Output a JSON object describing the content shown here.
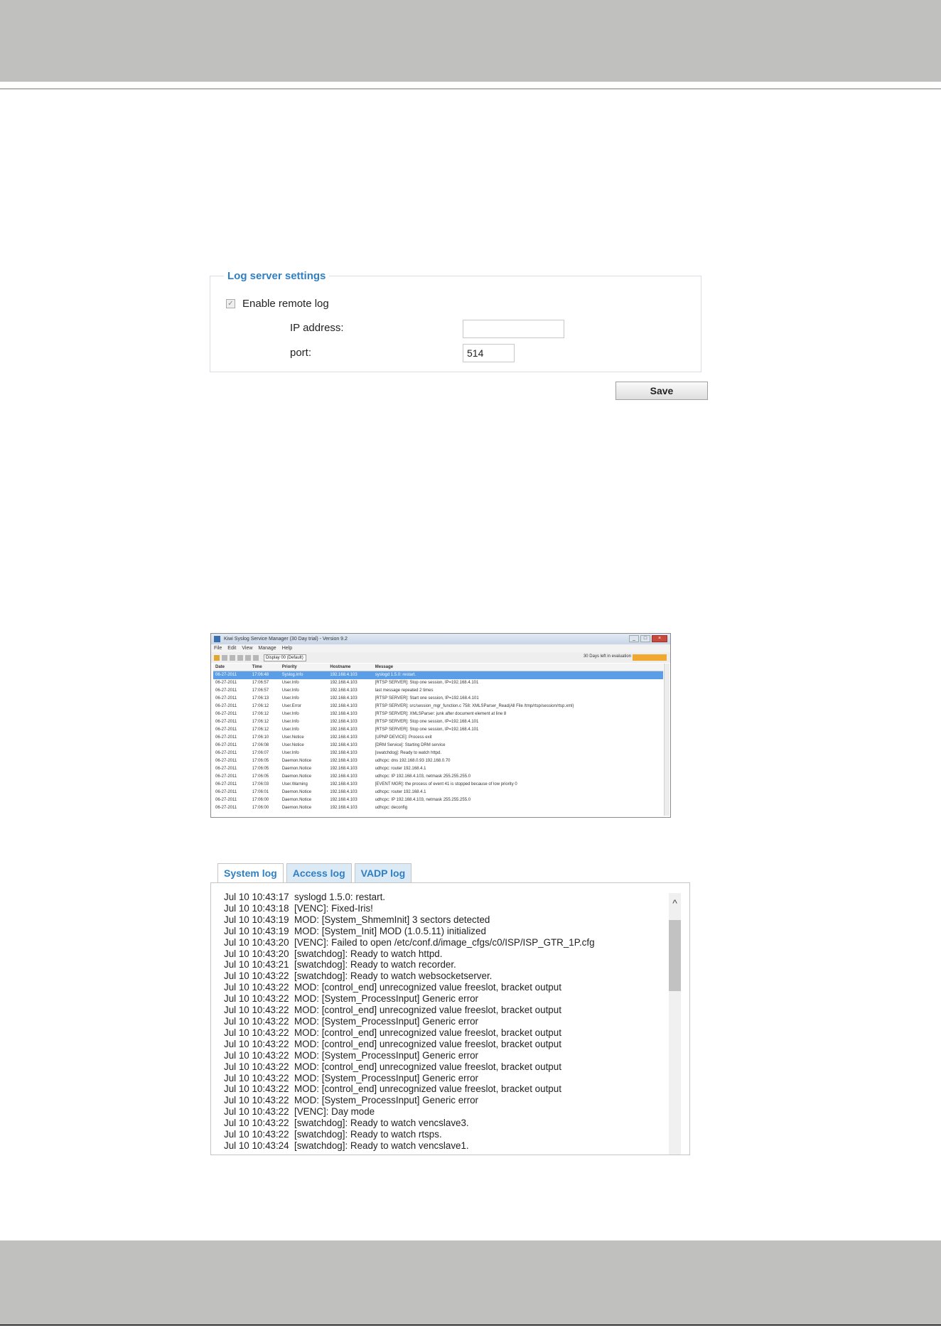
{
  "log_server": {
    "legend": "Log server settings",
    "enable_label": "Enable remote log",
    "check_mark": "✓",
    "ip_label": "IP address:",
    "ip_value": "",
    "port_label": "port:",
    "port_value": "514",
    "save_label": "Save"
  },
  "syslog_window": {
    "title": "Kiwi Syslog Service Manager (30 Day trial) - Version 9.2",
    "menu": [
      "File",
      "Edit",
      "View",
      "Manage",
      "Help"
    ],
    "display_select": "Display 00 (Default)",
    "trial_text": "30 Days left in evaluation",
    "columns": [
      "Date",
      "Time",
      "Priority",
      "Hostname",
      "Message"
    ],
    "rows": [
      [
        "06-27-2011",
        "17:06:48",
        "Syslog.Info",
        "192.168.4.103",
        "syslogd 1.5.0: restart."
      ],
      [
        "06-27-2011",
        "17:06:57",
        "User.Info",
        "192.168.4.103",
        "[RTSP SERVER]: Stop one session, IP=192.168.4.101"
      ],
      [
        "06-27-2011",
        "17:06:57",
        "User.Info",
        "192.168.4.103",
        "last message repeated 2 times"
      ],
      [
        "06-27-2011",
        "17:06:13",
        "User.Info",
        "192.168.4.103",
        "[RTSP SERVER]: Start one session, IP=192.168.4.101"
      ],
      [
        "06-27-2011",
        "17:06:12",
        "User.Error",
        "192.168.4.103",
        "[RTSP SERVER]: src/session_mgr_function.c 758: XMLSParser_Read(All File /tmp/rtsp/session/rtsp.xml)"
      ],
      [
        "06-27-2011",
        "17:06:12",
        "User.Info",
        "192.168.4.103",
        "[RTSP SERVER]: XMLSParser: junk after document element at line 8"
      ],
      [
        "06-27-2011",
        "17:06:12",
        "User.Info",
        "192.168.4.103",
        "[RTSP SERVER]: Stop one session, IP=192.168.4.101"
      ],
      [
        "06-27-2011",
        "17:06:12",
        "User.Info",
        "192.168.4.103",
        "[RTSP SERVER]: Stop one session, IP=192.168.4.101"
      ],
      [
        "06-27-2011",
        "17:06:10",
        "User.Notice",
        "192.168.4.103",
        "[UPNP DEVICE]: Process exit"
      ],
      [
        "06-27-2011",
        "17:06:08",
        "User.Notice",
        "192.168.4.103",
        "[DRM Service]: Starting DRM service"
      ],
      [
        "06-27-2011",
        "17:06:07",
        "User.Info",
        "192.168.4.103",
        "[swatchdog]: Ready to watch httpd."
      ],
      [
        "06-27-2011",
        "17:06:05",
        "Daemon.Notice",
        "192.168.4.103",
        "udhcpc: dns 192.168.0.93 192.168.0.70"
      ],
      [
        "06-27-2011",
        "17:06:05",
        "Daemon.Notice",
        "192.168.4.103",
        "udhcpc: router 192.168.4.1"
      ],
      [
        "06-27-2011",
        "17:06:05",
        "Daemon.Notice",
        "192.168.4.103",
        "udhcpc: IP 192.168.4.103, netmask 255.255.255.0"
      ],
      [
        "06-27-2011",
        "17:06:03",
        "User.Warning",
        "192.168.4.103",
        "[EVENT MGR]: the process of event 41 is stopped because of low priority 0"
      ],
      [
        "06-27-2011",
        "17:06:01",
        "Daemon.Notice",
        "192.168.4.103",
        "udhcpc: router 192.168.4.1"
      ],
      [
        "06-27-2011",
        "17:06:00",
        "Daemon.Notice",
        "192.168.4.103",
        "udhcpc: IP 192.168.4.103, netmask 255.255.255.0"
      ],
      [
        "06-27-2011",
        "17:06:00",
        "Daemon.Notice",
        "192.168.4.103",
        "udhcpc: deconfig"
      ]
    ]
  },
  "log_viewer": {
    "tabs": [
      "System log",
      "Access log",
      "VADP log"
    ],
    "active_tab": 0,
    "scroll_up_glyph": "^",
    "lines": [
      "Jul 10 10:43:17  syslogd 1.5.0: restart.",
      "Jul 10 10:43:18  [VENC]: Fixed-Iris!",
      "Jul 10 10:43:19  MOD: [System_ShmemInit] 3 sectors detected",
      "Jul 10 10:43:19  MOD: [System_Init] MOD (1.0.5.11) initialized",
      "Jul 10 10:43:20  [VENC]: Failed to open /etc/conf.d/image_cfgs/c0/ISP/ISP_GTR_1P.cfg",
      "Jul 10 10:43:20  [swatchdog]: Ready to watch httpd.",
      "Jul 10 10:43:21  [swatchdog]: Ready to watch recorder.",
      "Jul 10 10:43:22  [swatchdog]: Ready to watch websocketserver.",
      "Jul 10 10:43:22  MOD: [control_end] unrecognized value freeslot, bracket output",
      "Jul 10 10:43:22  MOD: [System_ProcessInput] Generic error",
      "Jul 10 10:43:22  MOD: [control_end] unrecognized value freeslot, bracket output",
      "Jul 10 10:43:22  MOD: [System_ProcessInput] Generic error",
      "Jul 10 10:43:22  MOD: [control_end] unrecognized value freeslot, bracket output",
      "Jul 10 10:43:22  MOD: [control_end] unrecognized value freeslot, bracket output",
      "Jul 10 10:43:22  MOD: [System_ProcessInput] Generic error",
      "Jul 10 10:43:22  MOD: [control_end] unrecognized value freeslot, bracket output",
      "Jul 10 10:43:22  MOD: [System_ProcessInput] Generic error",
      "Jul 10 10:43:22  MOD: [control_end] unrecognized value freeslot, bracket output",
      "Jul 10 10:43:22  MOD: [System_ProcessInput] Generic error",
      "Jul 10 10:43:22  [VENC]: Day mode",
      "Jul 10 10:43:22  [swatchdog]: Ready to watch vencslave3.",
      "Jul 10 10:43:22  [swatchdog]: Ready to watch rtsps.",
      "Jul 10 10:43:24  [swatchdog]: Ready to watch vencslave1."
    ]
  }
}
